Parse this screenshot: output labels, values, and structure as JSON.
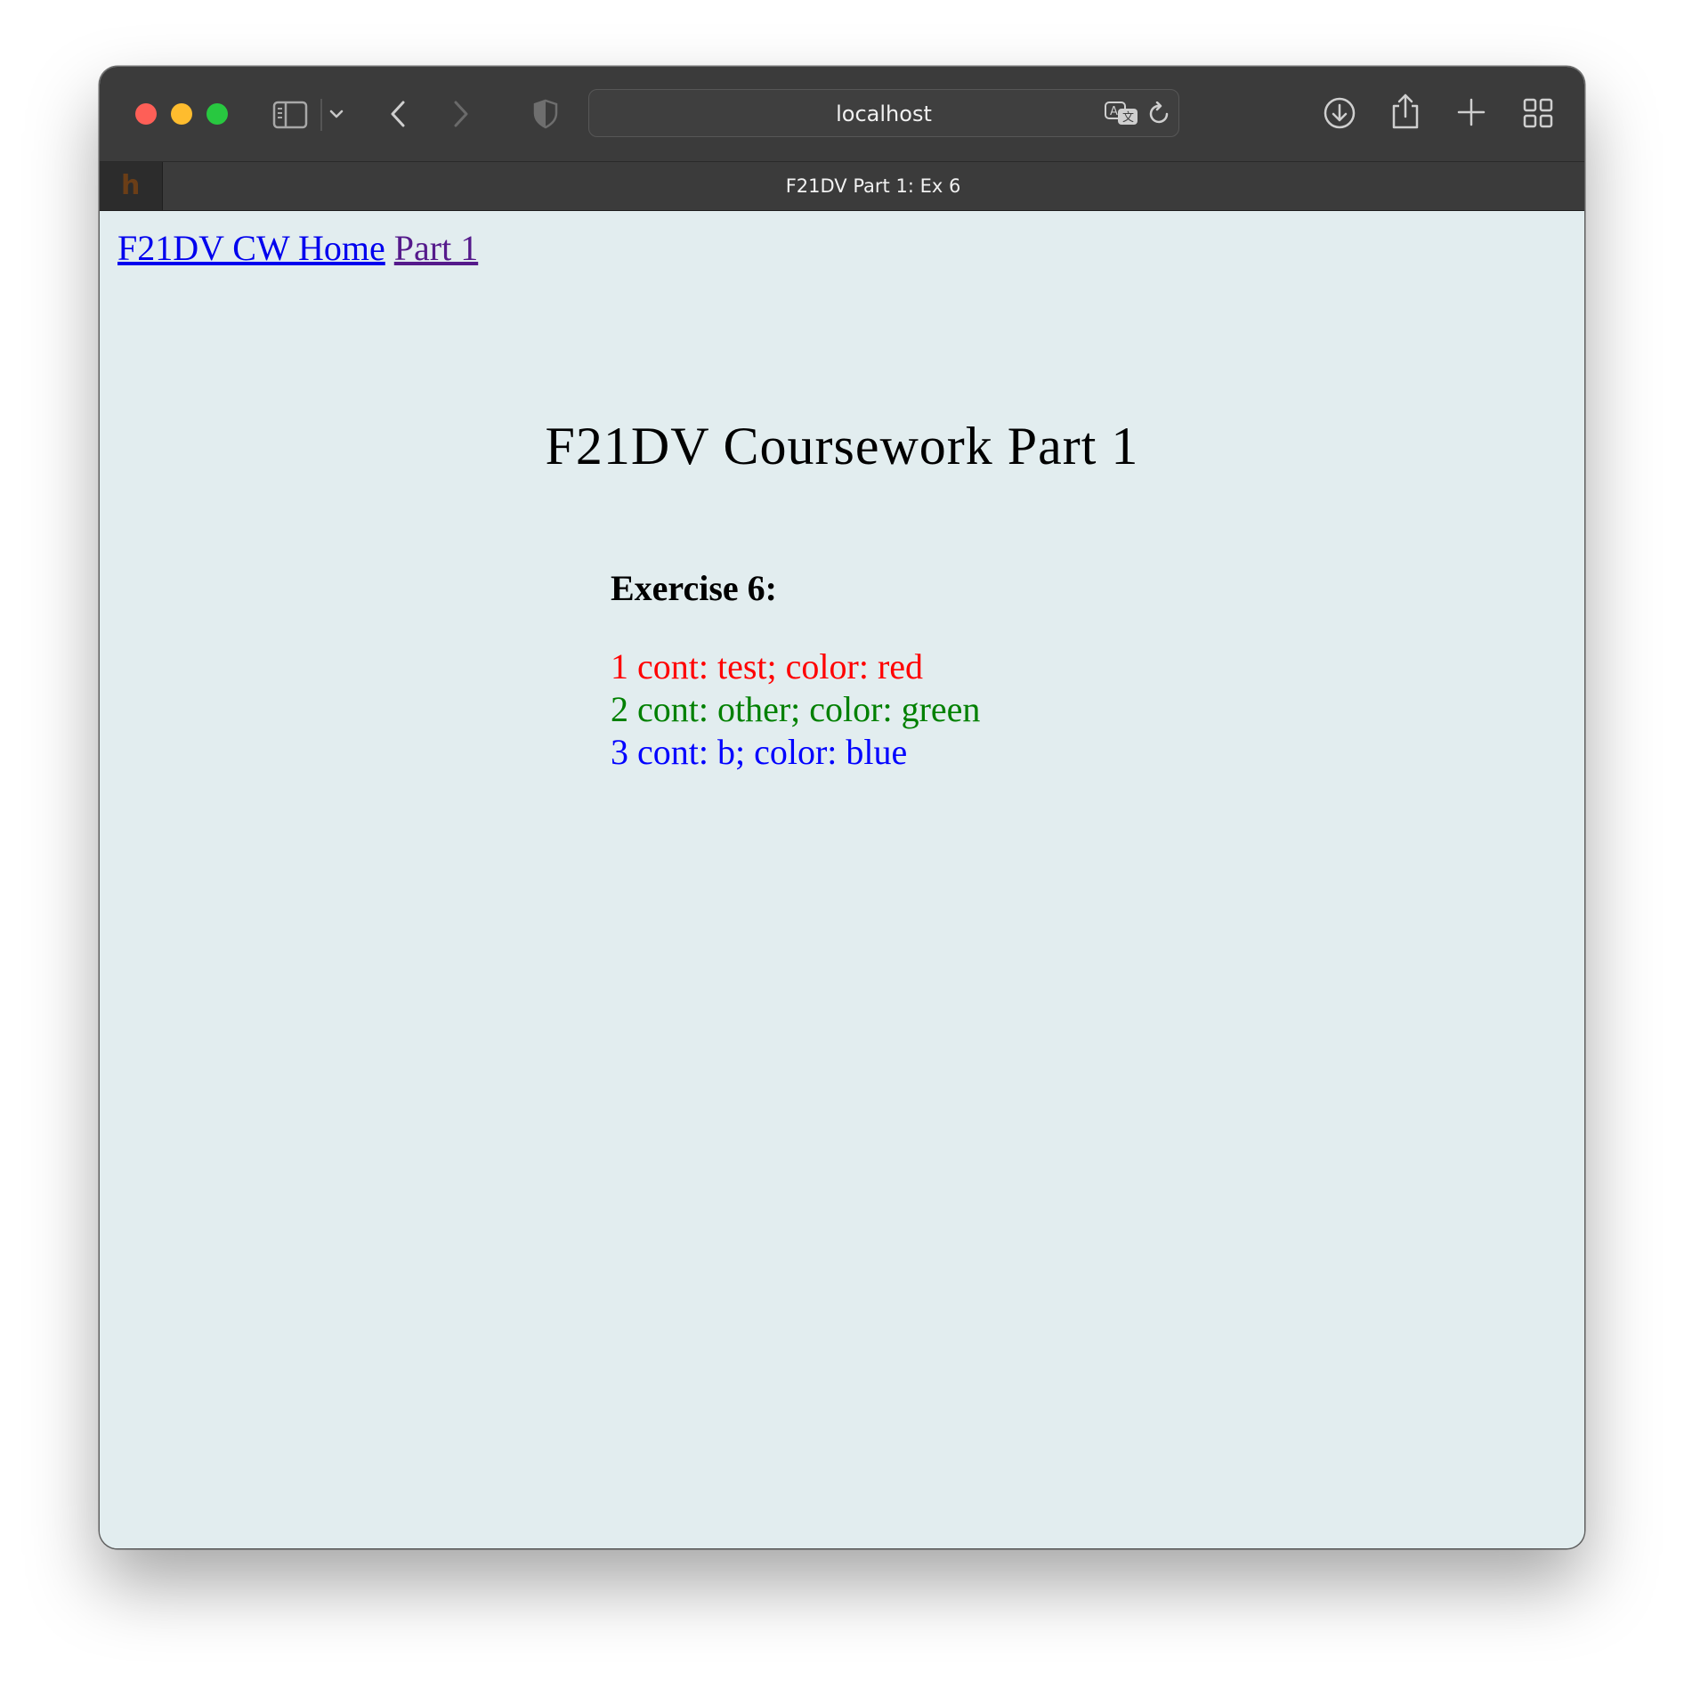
{
  "browser": {
    "address": "localhost",
    "tab_title": "F21DV Part 1: Ex 6",
    "tab_favicon": "h"
  },
  "nav": {
    "home_link": "F21DV CW Home",
    "part_link": "Part 1"
  },
  "page": {
    "heading": "F21DV Coursework Part 1",
    "exercise_title": "Exercise 6:",
    "items": [
      {
        "text": "1 cont: test; color: red",
        "color": "#ff0000"
      },
      {
        "text": "2 cont: other; color: green",
        "color": "#008000"
      },
      {
        "text": "3 cont: b; color: blue",
        "color": "#0000ff"
      }
    ]
  },
  "colors": {
    "page_background": "#e2edef",
    "toolbar": "#3b3b3b",
    "link": "#0000ee",
    "visited_link": "#551a8b"
  }
}
